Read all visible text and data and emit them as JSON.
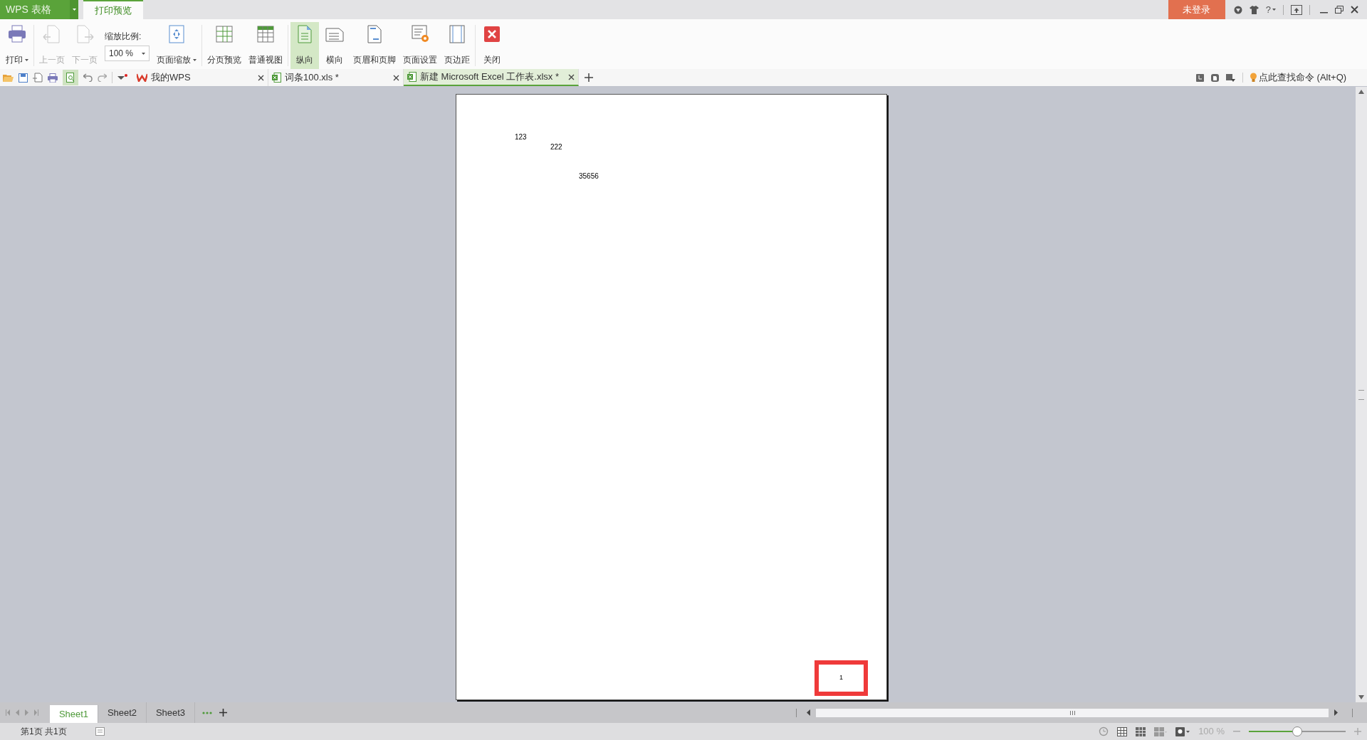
{
  "app_menu": {
    "label": "WPS 表格"
  },
  "ribbon_tabs": [
    {
      "label": "打印预览",
      "selected": true
    }
  ],
  "account": {
    "login": "未登录",
    "help": "?"
  },
  "ribbon": [
    [
      {
        "kind": "button",
        "label": "打印",
        "dropdown": true,
        "disabled": false,
        "selected": false
      }
    ],
    [
      {
        "kind": "button",
        "label": "上一页",
        "dropdown": false,
        "disabled": true,
        "selected": false
      },
      {
        "kind": "button",
        "label": "下一页",
        "dropdown": false,
        "disabled": true,
        "selected": false
      },
      {
        "kind": "zoom",
        "label": "缩放比例:",
        "value": "100 %"
      },
      {
        "kind": "button",
        "label": "页面缩放",
        "dropdown": true,
        "disabled": false,
        "selected": false
      }
    ],
    [
      {
        "kind": "button",
        "label": "分页预览",
        "dropdown": false,
        "disabled": false,
        "selected": false
      },
      {
        "kind": "button",
        "label": "普通视图",
        "dropdown": false,
        "disabled": false,
        "selected": false
      }
    ],
    [
      {
        "kind": "button",
        "label": "纵向",
        "dropdown": false,
        "disabled": false,
        "selected": true
      },
      {
        "kind": "button",
        "label": "横向",
        "dropdown": false,
        "disabled": false,
        "selected": false
      },
      {
        "kind": "button",
        "label": "页眉和页脚",
        "dropdown": false,
        "disabled": false,
        "selected": false
      },
      {
        "kind": "button",
        "label": "页面设置",
        "dropdown": false,
        "disabled": false,
        "selected": false
      },
      {
        "kind": "button",
        "label": "页边距",
        "dropdown": false,
        "disabled": false,
        "selected": false
      }
    ],
    [
      {
        "kind": "button",
        "label": "关闭",
        "dropdown": false,
        "disabled": false,
        "selected": false
      }
    ]
  ],
  "document_tabs": [
    {
      "label": "我的WPS",
      "selected": false
    },
    {
      "label": "词条100.xls *",
      "selected": false
    },
    {
      "label": "新建 Microsoft Excel 工作表.xlsx *",
      "selected": true
    }
  ],
  "command_search": {
    "placeholder": "点此查找命令 (Alt+Q)"
  },
  "page": {
    "cells": [
      {
        "text": "123"
      },
      {
        "text": "222"
      },
      {
        "text": "35656"
      }
    ],
    "page_number": "1"
  },
  "sheet_tabs": [
    {
      "label": "Sheet1",
      "selected": true
    },
    {
      "label": "Sheet2",
      "selected": false
    },
    {
      "label": "Sheet3",
      "selected": false
    }
  ],
  "status_bar": {
    "page_info": "第1页 共1页",
    "zoom": "100 %",
    "zoom_slider": {
      "level": 0.5
    }
  }
}
